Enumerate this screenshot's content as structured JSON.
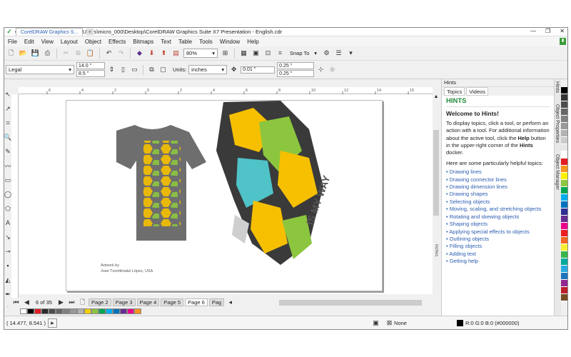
{
  "title": "CorelDRAW X7 (64-Bit) - C:\\Users\\micro_000\\Desktop\\CorelDRAW Graphics Suite X7 Presentation - English.cdr",
  "menu": [
    "File",
    "Edit",
    "View",
    "Layout",
    "Object",
    "Effects",
    "Bitmaps",
    "Text",
    "Table",
    "Tools",
    "Window",
    "Help"
  ],
  "toolbar": {
    "zoom": "80%",
    "snap_to": "Snap To"
  },
  "propbar": {
    "page_size": "Legal",
    "width": "14.0 \"",
    "height": "8.5 \"",
    "units_label": "Units:",
    "units": "inches",
    "nudge": "0.01 \"",
    "dup_x": "0.25 \"",
    "dup_y": "0.25 \""
  },
  "doc_tab": "CorelDRAW Graphics S...",
  "ruler_label": "inches",
  "ruler_ticks_h": [
    "6",
    "4",
    "2",
    "0",
    "2",
    "4",
    "6",
    "8",
    "10",
    "12",
    "14",
    "15"
  ],
  "art": {
    "credit_line1": "Artwork by",
    "credit_line2": "José Tzontlimatzi López, USA",
    "tagline": "IS MY WAY"
  },
  "pages": {
    "counter": "6 of 35",
    "tabs": [
      "Page 2",
      "Page 3",
      "Page 4",
      "Page 5",
      "Page 6",
      "Pag"
    ]
  },
  "status": {
    "coords": "( 14.477, 8.541 )",
    "fill_none": "None",
    "color_info": "R:0 G:0 B:0 (#000000)"
  },
  "docker": {
    "title": "Hints",
    "tabs": [
      "Topics",
      "Videos"
    ],
    "heading": "HINTS",
    "welcome": "Welcome to Hints!",
    "intro_pre": "To display topics, click a tool, or perform an action with a tool. For additional information about the active tool, click the ",
    "intro_bold1": "Help",
    "intro_mid": " button in the upper-right corner of the ",
    "intro_bold2": "Hints",
    "intro_post": " docker.",
    "helpful": "Here are some particularly helpful topics:",
    "topics": [
      "Drawing lines",
      "Drawing connector lines",
      "Drawing dimension lines",
      "Drawing shapes",
      "Selecting objects",
      "Moving, scaling, and stretching objects",
      "Rotating and skewing objects",
      "Shaping objects",
      "Applying special effects to objects",
      "Outlining objects",
      "Filling objects",
      "Adding text",
      "Getting help"
    ]
  },
  "side_tabs": [
    "Hints",
    "Object Properties",
    "Object Manager"
  ],
  "palette_colors": [
    "#ffffff",
    "#000000",
    "#e31c23",
    "#2b2b2b",
    "#4d4d4d",
    "#666666",
    "#808080",
    "#999999",
    "#b3b3b3",
    "#f5d000",
    "#8dc63f",
    "#00a651",
    "#00aeef",
    "#0072bc",
    "#662d91",
    "#ec008c",
    "#f7941d"
  ],
  "right_palette": [
    "#000000",
    "#333333",
    "#4d4d4d",
    "#666666",
    "#808080",
    "#999999",
    "#b3b3b3",
    "#cccccc",
    "#e6e6e6",
    "#ffffff",
    "#e31c23",
    "#f7941d",
    "#fff200",
    "#8dc63f",
    "#00a651",
    "#00aeef",
    "#0072bc",
    "#2e3192",
    "#662d91",
    "#ec008c",
    "#ed1c24",
    "#f26522",
    "#f9ed32",
    "#39b54a",
    "#00a99d",
    "#27aae1",
    "#1c75bc",
    "#92278f",
    "#be1e2d",
    "#754c24"
  ]
}
